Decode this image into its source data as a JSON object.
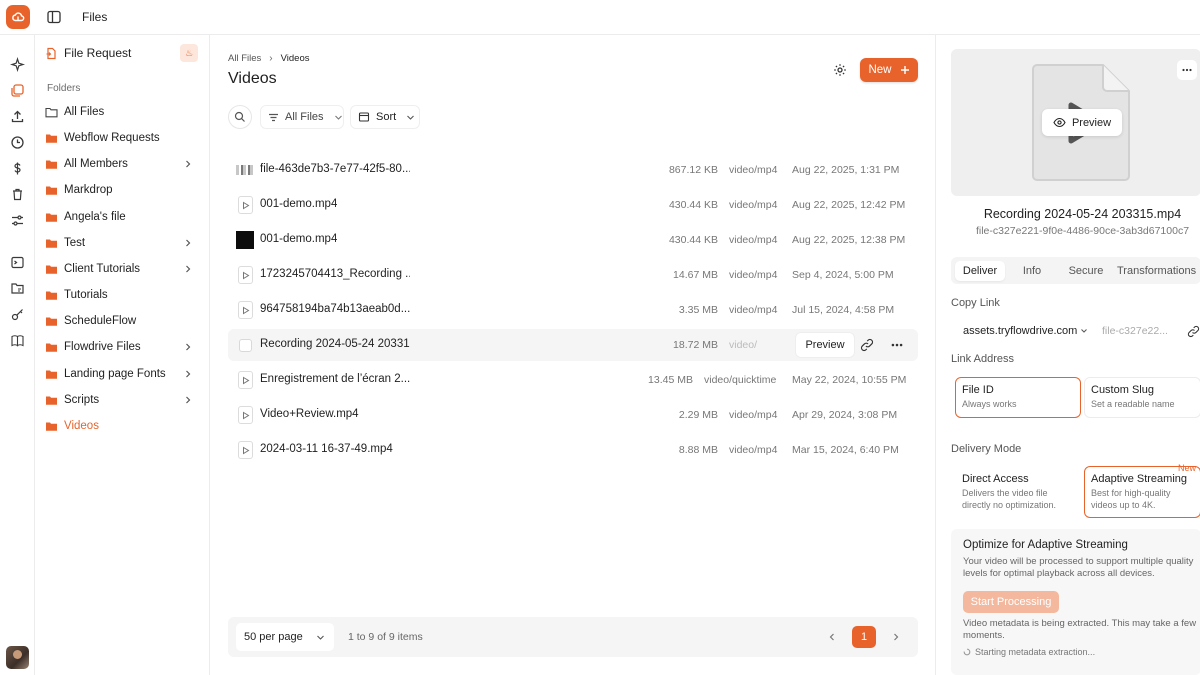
{
  "header": {
    "title": "Files"
  },
  "colors": {
    "accent": "#e8632b",
    "accent_light": "#f3b89d"
  },
  "rail": {
    "icons": [
      "sparkle-icon",
      "files-icon",
      "upload-icon",
      "clock-icon",
      "dollar-icon",
      "trash-icon",
      "settings-sliders-icon",
      "terminal-icon",
      "folder-tree-icon",
      "key-icon",
      "book-icon"
    ]
  },
  "sidebar": {
    "file_request_label": "File Request",
    "folders_heading": "Folders",
    "items": [
      {
        "label": "All Files",
        "icon": "folder-outline-icon",
        "chevron": false,
        "active": false
      },
      {
        "label": "Webflow Requests",
        "icon": "folder-icon",
        "chevron": false,
        "active": false
      },
      {
        "label": "All Members",
        "icon": "folder-icon",
        "chevron": true,
        "active": false
      },
      {
        "label": "Markdrop",
        "icon": "folder-icon",
        "chevron": false,
        "active": false
      },
      {
        "label": "Angela's file",
        "icon": "folder-icon",
        "chevron": false,
        "active": false
      },
      {
        "label": "Test",
        "icon": "folder-icon",
        "chevron": true,
        "active": false
      },
      {
        "label": "Client Tutorials",
        "icon": "folder-icon",
        "chevron": true,
        "active": false
      },
      {
        "label": "Tutorials",
        "icon": "folder-icon",
        "chevron": false,
        "active": false
      },
      {
        "label": "ScheduleFlow",
        "icon": "folder-icon",
        "chevron": false,
        "active": false
      },
      {
        "label": "Flowdrive Files",
        "icon": "folder-icon",
        "chevron": true,
        "active": false
      },
      {
        "label": "Landing page Fonts",
        "icon": "folder-icon",
        "chevron": true,
        "active": false
      },
      {
        "label": "Scripts",
        "icon": "folder-icon",
        "chevron": true,
        "active": false
      },
      {
        "label": "Videos",
        "icon": "folder-icon",
        "chevron": false,
        "active": true
      }
    ]
  },
  "main": {
    "breadcrumb": [
      "All Files",
      "Videos"
    ],
    "title": "Videos",
    "new_label": "New",
    "filter_label": "All Files",
    "sort_label": "Sort",
    "files": [
      {
        "name": "file-463de7b3-7e77-42f5-80...",
        "size": "867.12 KB",
        "type": "video/mp4",
        "date": "Aug 22, 2025, 1:31 PM",
        "thumb": "strip"
      },
      {
        "name": "001-demo.mp4",
        "size": "430.44 KB",
        "type": "video/mp4",
        "date": "Aug 22, 2025, 12:42 PM",
        "thumb": "doc"
      },
      {
        "name": "001-demo.mp4",
        "size": "430.44 KB",
        "type": "video/mp4",
        "date": "Aug 22, 2025, 12:38 PM",
        "thumb": "dark"
      },
      {
        "name": "1723245704413_Recording ...",
        "size": "14.67 MB",
        "type": "video/mp4",
        "date": "Sep 4, 2024, 5:00 PM",
        "thumb": "doc"
      },
      {
        "name": "964758194ba74b13aeab0d...",
        "size": "3.35 MB",
        "type": "video/mp4",
        "date": "Jul 15, 2024, 4:58 PM",
        "thumb": "doc"
      },
      {
        "name": "Recording 2024-05-24 203315",
        "size": "18.72 MB",
        "type": "video/mp4",
        "date": "",
        "thumb": "checkbox",
        "hover": true,
        "type_faded": "video/"
      },
      {
        "name": "Enregistrement de l’écran 2...",
        "size": "13.45 MB",
        "type": "video/quicktime",
        "date": "May 22, 2024, 10:55 PM",
        "thumb": "doc"
      },
      {
        "name": "Video+Review.mp4",
        "size": "2.29 MB",
        "type": "video/mp4",
        "date": "Apr 29, 2024, 3:08 PM",
        "thumb": "doc"
      },
      {
        "name": "2024-03-11 16-37-49.mp4",
        "size": "8.88 MB",
        "type": "video/mp4",
        "date": "Mar 15, 2024, 6:40 PM",
        "thumb": "doc"
      }
    ],
    "row_preview_label": "Preview",
    "pagination": {
      "per_page": "50 per page",
      "summary": "1 to 9 of 9 items",
      "current_page": "1"
    }
  },
  "details": {
    "preview_label": "Preview",
    "file_title": "Recording 2024-05-24 203315.mp4",
    "file_id": "file-c327e221-9f0e-4486-90ce-3ab3d67100c7",
    "tabs": [
      "Deliver",
      "Info",
      "Secure",
      "Transformations"
    ],
    "copy_link_label": "Copy Link",
    "domain": "assets.tryflowdrive.com",
    "path_preview": "file-c327e22...",
    "link_address_label": "Link Address",
    "link_options": [
      {
        "title": "File ID",
        "desc": "Always works"
      },
      {
        "title": "Custom Slug",
        "desc": "Set a readable name"
      }
    ],
    "delivery_mode_label": "Delivery Mode",
    "delivery_options": [
      {
        "title": "Direct Access",
        "desc": "Delivers the video file directly no optimization."
      },
      {
        "title": "Adaptive Streaming",
        "desc": "Best for high-quality videos up to 4K.",
        "tag": "New"
      }
    ],
    "optimize": {
      "title": "Optimize for Adaptive Streaming",
      "desc": "Your video will be processed to support multiple quality levels for optimal playback across all devices.",
      "button": "Start Processing",
      "note": "Video metadata is being extracted. This may take a few moments.",
      "status": "Starting metadata extraction..."
    }
  }
}
